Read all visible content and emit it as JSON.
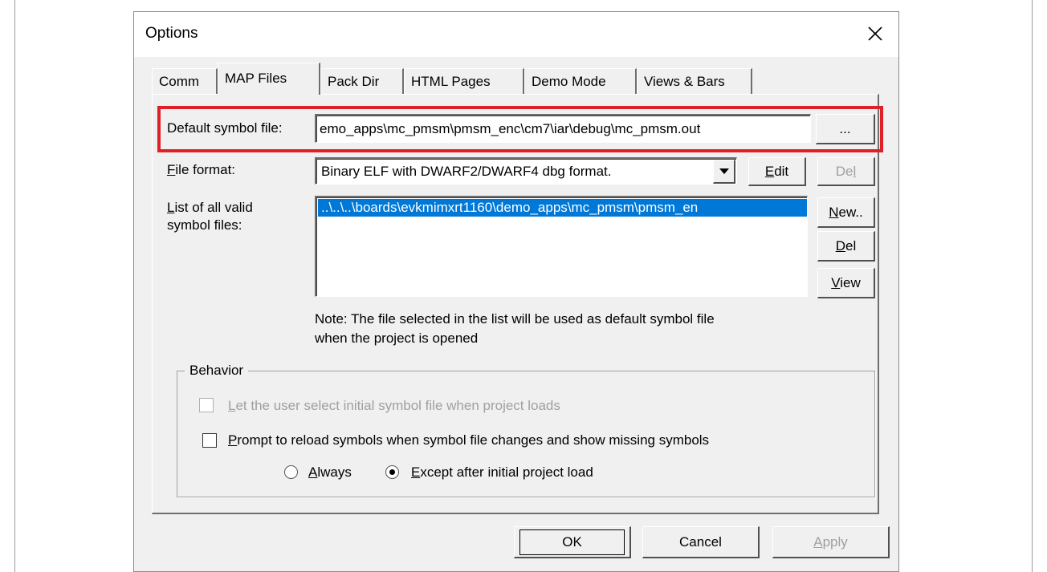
{
  "dialog": {
    "title": "Options"
  },
  "tabs": [
    {
      "label": "Comm",
      "active": false
    },
    {
      "label": "MAP Files",
      "active": true
    },
    {
      "label": "Pack Dir",
      "active": false
    },
    {
      "label": "HTML Pages",
      "active": false
    },
    {
      "label": "Demo Mode",
      "active": false
    },
    {
      "label": "Views & Bars",
      "active": false
    }
  ],
  "map_files": {
    "default_symbol_label": "Default symbol file:",
    "default_symbol_value": "emo_apps\\mc_pmsm\\pmsm_enc\\cm7\\iar\\debug\\mc_pmsm.out",
    "browse_label": "...",
    "file_format_label_first": "F",
    "file_format_label_rest": "ile format:",
    "file_format_value": "Binary ELF with DWARF2/DWARF4 dbg format.",
    "edit_label_first": "E",
    "edit_label_rest": "dit",
    "del_format_label_first": "De",
    "del_format_label_u": "l",
    "list_label_first": "L",
    "list_label_line1_rest": "ist of all valid",
    "list_label_line2": "symbol files:",
    "list_items": [
      "..\\..\\..\\boards\\evkmimxrt1160\\demo_apps\\mc_pmsm\\pmsm_en"
    ],
    "new_label_first": "N",
    "new_label_rest": "ew..",
    "del_label_first": "D",
    "del_label_rest": "el",
    "view_label_first": "V",
    "view_label_rest": "iew",
    "note_line1": "Note: The file selected in the list will be used as default symbol file",
    "note_line2": "when the project is opened"
  },
  "behavior": {
    "group_title": "Behavior",
    "let_user_first": "L",
    "let_user_rest": "et the user select initial symbol file when project loads",
    "prompt_first": "P",
    "prompt_rest": "rompt to reload symbols when symbol file changes and show missing symbols",
    "always_first": "A",
    "always_rest": "lways",
    "except_first": "E",
    "except_rest": "xcept after initial project load"
  },
  "buttons": {
    "ok": "OK",
    "cancel": "Cancel",
    "apply_first": "A",
    "apply_rest": "pply"
  },
  "colors": {
    "selection": "#0078d7",
    "highlight": "#e02027"
  }
}
